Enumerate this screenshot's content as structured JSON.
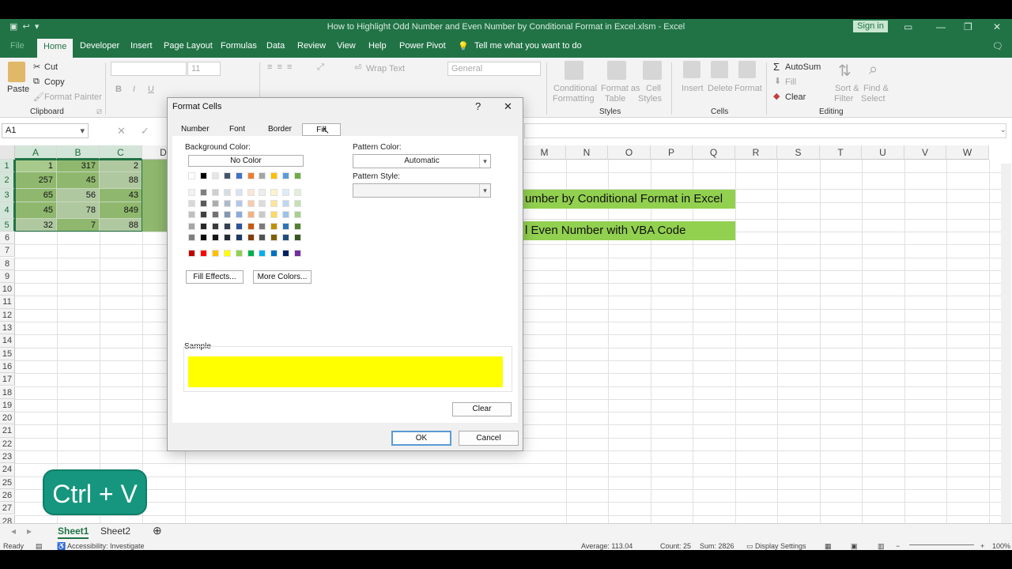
{
  "window": {
    "title": "How to Highlight Odd Number and Even Number by Conditional Format in Excel.xlsm  -  Excel",
    "sign_in": "Sign in"
  },
  "ribbon_tabs": [
    "File",
    "Home",
    "Developer",
    "Insert",
    "Page Layout",
    "Formulas",
    "Data",
    "Review",
    "View",
    "Help",
    "Power Pivot"
  ],
  "tell_me": "Tell me what you want to do",
  "ribbon": {
    "paste": "Paste",
    "cut": "Cut",
    "copy": "Copy",
    "format_painter": "Format Painter",
    "clipboard": "Clipboard",
    "font_size": "11",
    "wrap_text": "Wrap Text",
    "number_format": "General",
    "conditional_formatting_1": "Conditional",
    "conditional_formatting_2": "Formatting",
    "format_as_table_1": "Format as",
    "format_as_table_2": "Table",
    "cell_styles_1": "Cell",
    "cell_styles_2": "Styles",
    "styles": "Styles",
    "insert": "Insert",
    "delete": "Delete",
    "format": "Format",
    "cells": "Cells",
    "autosum": "AutoSum",
    "fill": "Fill",
    "clear": "Clear",
    "sort_filter_1": "Sort &",
    "sort_filter_2": "Filter",
    "find_select_1": "Find &",
    "find_select_2": "Select",
    "editing": "Editing"
  },
  "namebox": "A1",
  "columns": [
    "A",
    "B",
    "C",
    "D",
    "M",
    "N",
    "O",
    "P",
    "Q",
    "R",
    "S",
    "T",
    "U",
    "V",
    "W"
  ],
  "rows": [
    "1",
    "2",
    "3",
    "4",
    "5",
    "6",
    "7",
    "8",
    "9",
    "10",
    "11",
    "12",
    "13",
    "14",
    "15",
    "16",
    "17",
    "18",
    "19",
    "20",
    "21",
    "22",
    "23",
    "24",
    "25",
    "26",
    "27",
    "28"
  ],
  "cells": [
    [
      "1",
      "317",
      "2"
    ],
    [
      "257",
      "45",
      "88"
    ],
    [
      "65",
      "56",
      "43"
    ],
    [
      "45",
      "78",
      "849"
    ],
    [
      "32",
      "7",
      "88"
    ]
  ],
  "banners": {
    "line1": "umber by Conditional Format in Excel",
    "line2": "l Even Number with VBA Code"
  },
  "sheets": [
    "Sheet1",
    "Sheet2"
  ],
  "status": {
    "ready": "Ready",
    "accessibility": "Accessibility: Investigate",
    "average": "Average: 113.04",
    "count": "Count: 25",
    "sum": "Sum: 2826",
    "display_settings": "Display Settings",
    "zoom": "100%"
  },
  "overlay": {
    "shortcut": "Ctrl + V"
  },
  "dialog": {
    "title": "Format Cells",
    "help": "?",
    "close": "✕",
    "tabs": [
      "Number",
      "Font",
      "Border",
      "Fill"
    ],
    "background_color": "Background Color:",
    "no_color": "No Color",
    "fill_effects": "Fill Effects...",
    "more_colors": "More Colors...",
    "pattern_color": "Pattern Color:",
    "pattern_color_value": "Automatic",
    "pattern_style": "Pattern Style:",
    "sample": "Sample",
    "sample_color": "#ffff00",
    "clear": "Clear",
    "ok": "OK",
    "cancel": "Cancel",
    "theme_top": [
      "#ffffff",
      "#000000",
      "#e7e6e6",
      "#44546a",
      "#4472c4",
      "#ed7d31",
      "#a5a5a5",
      "#ffc000",
      "#5b9bd5",
      "#70ad47"
    ],
    "theme_tints": [
      [
        "#f2f2f2",
        "#7f7f7f",
        "#d0cece",
        "#d6dce4",
        "#d9e2f3",
        "#fbe5d5",
        "#ededed",
        "#fff2cc",
        "#deebf6",
        "#e2efd9"
      ],
      [
        "#d8d8d8",
        "#595959",
        "#aeabab",
        "#adb9ca",
        "#b4c6e7",
        "#f7cbac",
        "#dbdbdb",
        "#fee599",
        "#bdd7ee",
        "#c5e0b3"
      ],
      [
        "#bfbfbf",
        "#3f3f3f",
        "#757070",
        "#8496b0",
        "#8eaadb",
        "#f4b183",
        "#c9c9c9",
        "#ffd965",
        "#9dc3e6",
        "#a8d08d"
      ],
      [
        "#a5a5a5",
        "#262626",
        "#3a3838",
        "#323f4f",
        "#2f5496",
        "#c55a11",
        "#7b7b7b",
        "#bf9000",
        "#2e75b5",
        "#538135"
      ],
      [
        "#7f7f7f",
        "#0c0c0c",
        "#171616",
        "#222a35",
        "#1f3864",
        "#833c0b",
        "#525252",
        "#7f6000",
        "#1e4e79",
        "#375623"
      ]
    ],
    "standard": [
      "#c00000",
      "#ff0000",
      "#ffc000",
      "#ffff00",
      "#92d050",
      "#00b050",
      "#00b0f0",
      "#0070c0",
      "#002060",
      "#7030a0"
    ]
  }
}
